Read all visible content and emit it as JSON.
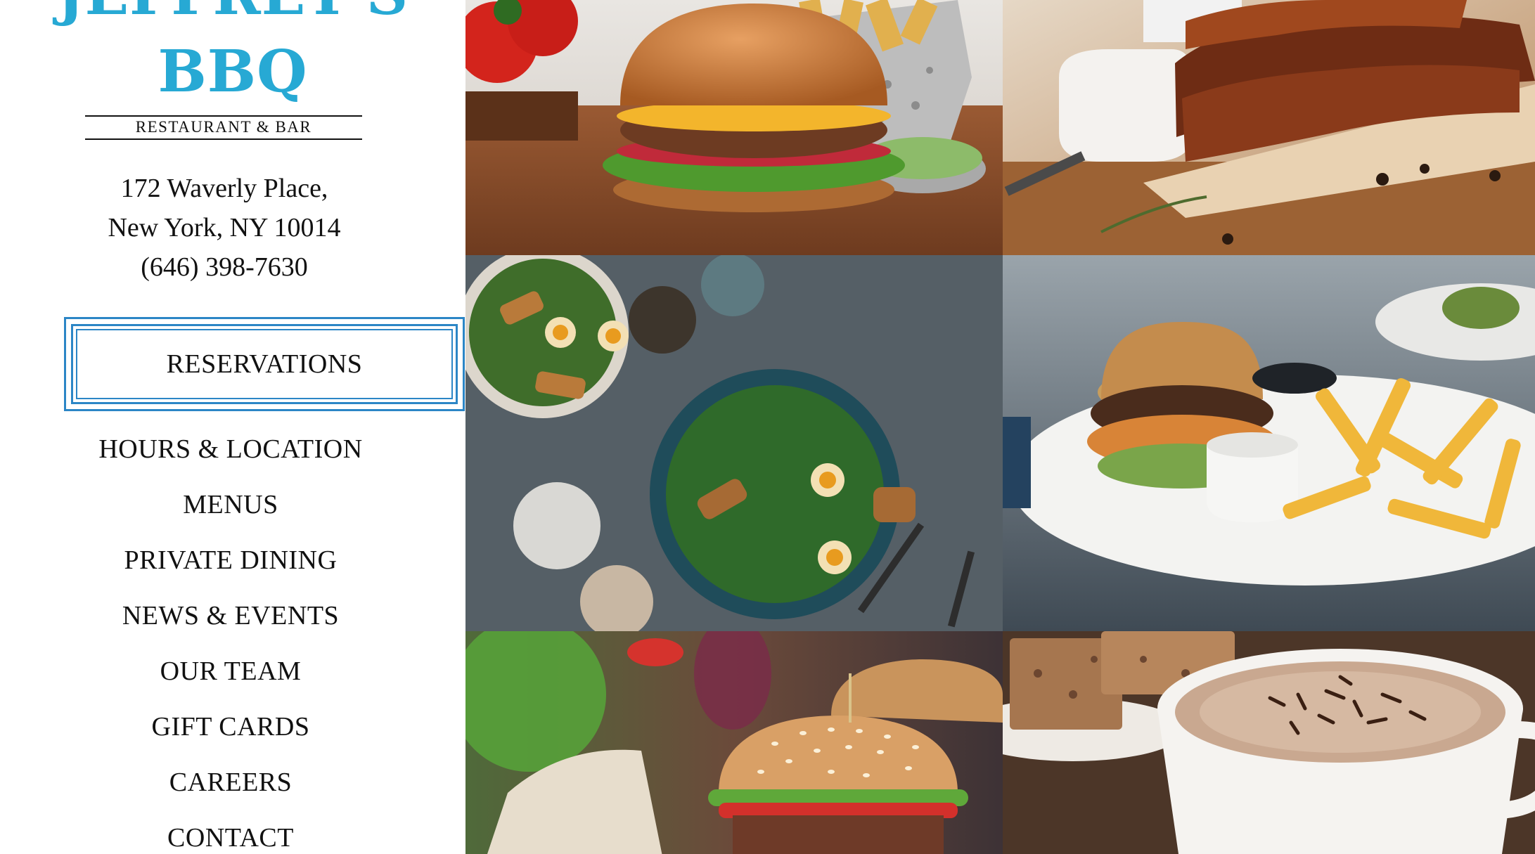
{
  "brand": {
    "name_line1": "JEFFREY'S",
    "name_line2": "BBQ",
    "subtitle": "RESTAURANT & BAR",
    "color": "#27a9d4"
  },
  "contact": {
    "street": "172 Waverly Place,",
    "city": "New York, NY 10014",
    "phone": "(646) 398-7630"
  },
  "reservations": {
    "label": "RESERVATIONS",
    "border_color": "#2c86c6"
  },
  "nav": [
    {
      "label": "HOURS & LOCATION"
    },
    {
      "label": "MENUS"
    },
    {
      "label": "PRIVATE DINING"
    },
    {
      "label": "NEWS & EVENTS"
    },
    {
      "label": "OUR TEAM"
    },
    {
      "label": "GIFT CARDS"
    },
    {
      "label": "CAREERS"
    },
    {
      "label": "CONTACT"
    }
  ],
  "gallery": [
    {
      "subject": "cheeseburger-with-fries"
    },
    {
      "subject": "bbq-ribs"
    },
    {
      "subject": "kale-salads-with-eggs"
    },
    {
      "subject": "burger-plate-with-fries"
    },
    {
      "subject": "sesame-burgers"
    },
    {
      "subject": "hot-chocolate-and-brownies"
    }
  ]
}
